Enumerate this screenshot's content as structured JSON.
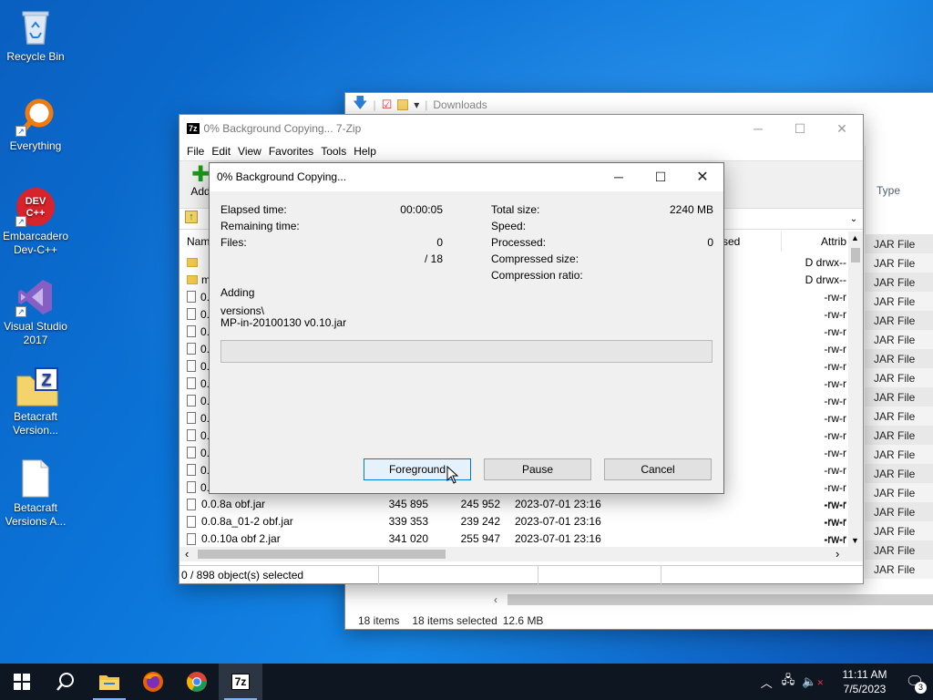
{
  "desktop": {
    "icons": [
      {
        "label": "Recycle Bin",
        "icon": "recycle-bin-icon"
      },
      {
        "label": "Everything",
        "icon": "everything-search-icon"
      },
      {
        "label": "Embarcadero Dev-C++",
        "icon": "devcpp-icon",
        "badge": "DEV\nC++"
      },
      {
        "label": "Visual Studio 2017",
        "icon": "visual-studio-icon"
      },
      {
        "label": "Betacraft Version...",
        "icon": "zip-folder-icon"
      },
      {
        "label": "Betacraft Versions A...",
        "icon": "blank-file-icon"
      }
    ]
  },
  "explorer": {
    "address": "Downloads",
    "column_type": "Type",
    "type_values": [
      "JAR File",
      "JAR File",
      "JAR File",
      "JAR File",
      "JAR File",
      "JAR File",
      "JAR File",
      "JAR File",
      "JAR File",
      "JAR File",
      "JAR File",
      "JAR File",
      "JAR File",
      "JAR File",
      "JAR File",
      "JAR File",
      "JAR File",
      "JAR File"
    ],
    "status": {
      "items": "18 items",
      "selected": "18 items selected",
      "size": "12.6 MB"
    }
  },
  "sevenzip": {
    "title": "0% Background Copying... 7-Zip",
    "app_icon_text": "7z",
    "menu": [
      "File",
      "Edit",
      "View",
      "Favorites",
      "Tools",
      "Help"
    ],
    "toolbar_add": "Add",
    "columns": {
      "name": "Name",
      "packed": "sed",
      "attrib": "Attrib"
    },
    "attrib_values": [
      "D drwx--",
      "D drwx--",
      "-rw-r",
      "-rw-r",
      "-rw-r",
      "-rw-r",
      "-rw-r",
      "-rw-r",
      "-rw-r",
      "-rw-r",
      "-rw-r",
      "-rw-r",
      "-rw-r",
      "-rw-r",
      "-rw-r",
      "-rw-r",
      "-rw-r"
    ],
    "name_stubs": [
      "",
      "m",
      "0.",
      "0.",
      "0.",
      "0.",
      "0.",
      "0.",
      "0.",
      "0.",
      "0.",
      "0.",
      "0.",
      "0."
    ],
    "rows": [
      {
        "name": "0.0.8a obf.jar",
        "size": "345 895",
        "packed": "245 952",
        "modified": "2023-07-01 23:16",
        "attrib": "-rw-r"
      },
      {
        "name": "0.0.8a_01-2 obf.jar",
        "size": "339 353",
        "packed": "239 242",
        "modified": "2023-07-01 23:16",
        "attrib": "-rw-r"
      },
      {
        "name": "0.0.10a obf 2.jar",
        "size": "341 020",
        "packed": "255 947",
        "modified": "2023-07-01 23:16",
        "attrib": "-rw-r"
      }
    ],
    "status": "0 / 898 object(s) selected"
  },
  "progress_dialog": {
    "title": "0% Background Copying...",
    "elapsed_label": "Elapsed time:",
    "elapsed_value": "00:00:05",
    "remaining_label": "Remaining time:",
    "files_label": "Files:",
    "files_value": "0",
    "files_total": "/ 18",
    "total_size_label": "Total size:",
    "total_size_value": "2240 MB",
    "speed_label": "Speed:",
    "processed_label": "Processed:",
    "processed_value": "0",
    "compressed_label": "Compressed size:",
    "ratio_label": "Compression ratio:",
    "operation": "Adding",
    "current_path": "versions\\",
    "current_file": "MP-in-20100130 v0.10.jar",
    "progress_fraction": 0,
    "buttons": {
      "foreground": "Foreground",
      "pause": "Pause",
      "cancel": "Cancel"
    }
  },
  "taskbar": {
    "time": "11:11 AM",
    "date": "7/5/2023",
    "notification_count": "3",
    "pinned": [
      "start-icon",
      "search-icon",
      "file-explorer-icon",
      "firefox-icon",
      "chrome-icon",
      "7zip-icon"
    ]
  }
}
